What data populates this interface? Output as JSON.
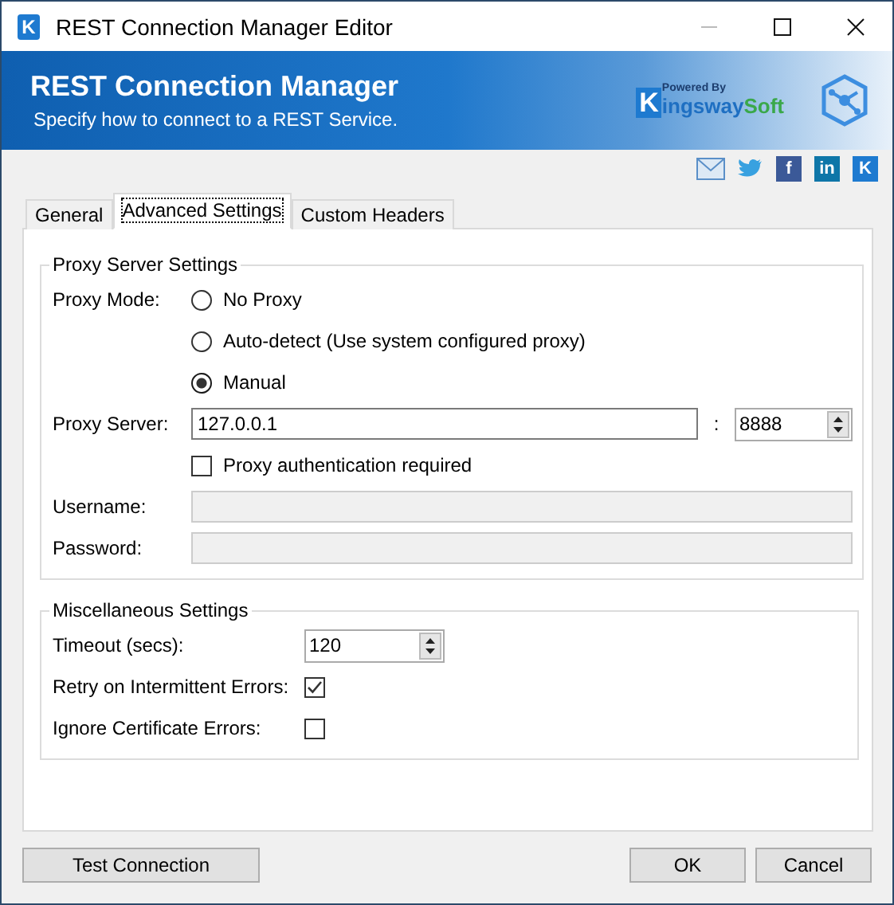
{
  "window": {
    "title": "REST Connection Manager Editor",
    "app_icon_glyph": "K"
  },
  "banner": {
    "title": "REST Connection Manager",
    "subtitle": "Specify how to connect to a REST Service.",
    "logo": {
      "glyph": "K",
      "tagline": "Powered By",
      "name_main": "ingsway",
      "name_accent": "Soft"
    }
  },
  "social": [
    {
      "kind": "mail"
    },
    {
      "kind": "twitter"
    },
    {
      "kind": "facebook",
      "glyph": "f"
    },
    {
      "kind": "linkedin",
      "glyph": "in"
    },
    {
      "kind": "kingsway",
      "glyph": "K"
    }
  ],
  "tabs": [
    {
      "label": "General",
      "selected": false
    },
    {
      "label": "Advanced Settings",
      "selected": true
    },
    {
      "label": "Custom Headers",
      "selected": false
    }
  ],
  "proxy": {
    "title": "Proxy Server Settings",
    "mode_label": "Proxy Mode:",
    "modes": [
      {
        "label": "No Proxy",
        "selected": false
      },
      {
        "label": "Auto-detect (Use system configured proxy)",
        "selected": false
      },
      {
        "label": "Manual",
        "selected": true
      }
    ],
    "server_label": "Proxy Server:",
    "server_value": "127.0.0.1",
    "separator": ":",
    "port_value": "8888",
    "auth": {
      "label": "Proxy authentication required",
      "checked": false
    },
    "username_label": "Username:",
    "username_disabled": true,
    "password_label": "Password:",
    "password_disabled": true
  },
  "misc": {
    "title": "Miscellaneous Settings",
    "timeout_label": "Timeout (secs):",
    "timeout_value": "120",
    "options": [
      {
        "label": "Retry on Intermittent Errors:",
        "checked": true
      },
      {
        "label": "Ignore Certificate Errors:",
        "checked": false
      }
    ]
  },
  "buttons": {
    "test": "Test Connection",
    "ok": "OK",
    "cancel": "Cancel"
  }
}
